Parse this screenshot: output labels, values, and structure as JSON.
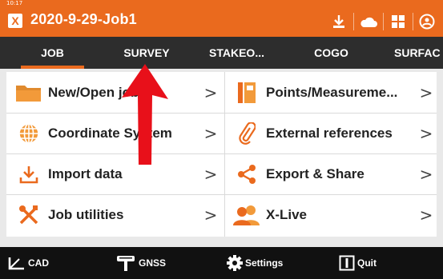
{
  "status_bar": {
    "time": "10:17"
  },
  "header": {
    "logo_glyph": "X",
    "job_title": "2020-9-29-Job1",
    "icons": [
      "download-icon",
      "cloud-icon",
      "grid-icon",
      "satellite-icon"
    ]
  },
  "tabs": [
    {
      "label": "JOB",
      "active": true
    },
    {
      "label": "SURVEY",
      "active": false
    },
    {
      "label": "STAKEO...",
      "active": false
    },
    {
      "label": "COGO",
      "active": false
    },
    {
      "label": "SURFAC",
      "active": false
    }
  ],
  "menu": {
    "left": [
      {
        "label": "New/Open job",
        "icon": "folder-icon"
      },
      {
        "label": "Coordinate System",
        "icon": "globe-icon"
      },
      {
        "label": "Import data",
        "icon": "import-icon"
      },
      {
        "label": "Job utilities",
        "icon": "tools-icon"
      }
    ],
    "right": [
      {
        "label": "Points/Measureme...",
        "icon": "points-book-icon"
      },
      {
        "label": "External references",
        "icon": "paperclip-icon"
      },
      {
        "label": "Export & Share",
        "icon": "share-icon"
      },
      {
        "label": "X-Live",
        "icon": "users-icon"
      }
    ],
    "chevron": ">"
  },
  "bottom_bar": {
    "cad": "CAD",
    "gnss": "GNSS",
    "settings": "Settings",
    "quit": "Quit"
  },
  "colors": {
    "accent": "#ea6a1e",
    "tab_bg": "#2d2d2d",
    "bottom_bg": "#111111",
    "arrow": "#e8101a"
  }
}
